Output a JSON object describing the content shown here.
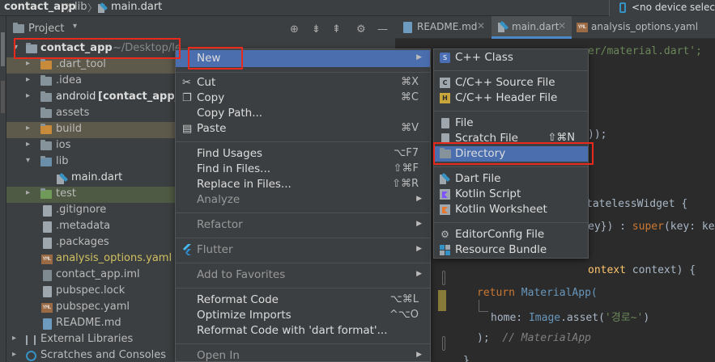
{
  "breadcrumb": {
    "project": "contact_app",
    "folder": "lib",
    "file": "main.dart"
  },
  "device": {
    "label": "<no device selected>"
  },
  "project_panel": {
    "title": "Project",
    "root": {
      "name": "contact_app",
      "path": "~/Desktop/le"
    },
    "items": [
      {
        "label": ".dart_tool",
        "kind": "folder"
      },
      {
        "label": ".idea",
        "kind": "folder"
      },
      {
        "label": "android",
        "bold": "[contact_app_a",
        "kind": "folder"
      },
      {
        "label": "assets",
        "kind": "folder"
      },
      {
        "label": "build",
        "kind": "folder"
      },
      {
        "label": "ios",
        "kind": "folder"
      },
      {
        "label": "lib",
        "kind": "folder"
      },
      {
        "label": "main.dart",
        "kind": "dart"
      },
      {
        "label": "test",
        "kind": "folder"
      },
      {
        "label": ".gitignore",
        "kind": "file"
      },
      {
        "label": ".metadata",
        "kind": "file"
      },
      {
        "label": ".packages",
        "kind": "file"
      },
      {
        "label": "analysis_options.yaml",
        "kind": "yml"
      },
      {
        "label": "contact_app.iml",
        "kind": "file"
      },
      {
        "label": "pubspec.lock",
        "kind": "file"
      },
      {
        "label": "pubspec.yaml",
        "kind": "yml"
      },
      {
        "label": "README.md",
        "kind": "file"
      },
      {
        "label": "External Libraries",
        "kind": "ext"
      },
      {
        "label": "Scratches and Consoles",
        "kind": "scratch"
      }
    ]
  },
  "editor": {
    "tabs": [
      {
        "label": "README.md"
      },
      {
        "label": "main.dart"
      },
      {
        "label": "analysis_options.yaml"
      }
    ],
    "code": {
      "l1": "er/material.dart';",
      "l2": "));",
      "l3a": "tatelessWidget",
      "l3b": " {",
      "l4a": "ey}) : ",
      "l4b": "super",
      "l4c": "(key: ke",
      "l5a": "ontext",
      "l5b": " context) {",
      "l6a": "return",
      "l6b": "MaterialApp(",
      "l7a": "home: ",
      "l7b": "Image",
      "l7c": ".asset(",
      "l7d": "'경로~'",
      "l7e": ")",
      "l8a": ");  ",
      "l8b": "// MaterialApp",
      "l9": "}"
    }
  },
  "context_menu": {
    "items": [
      {
        "label": "New",
        "submenu": true
      },
      {
        "label": "Cut",
        "shortcut": "⌘X",
        "icon": "scissors-icon"
      },
      {
        "label": "Copy",
        "shortcut": "⌘C",
        "icon": "copy-icon"
      },
      {
        "label": "Copy Path..."
      },
      {
        "label": "Paste",
        "shortcut": "⌘V",
        "icon": "paste-icon"
      },
      {
        "label": "Find Usages",
        "shortcut": "⌥F7"
      },
      {
        "label": "Find in Files...",
        "shortcut": "⇧⌘F"
      },
      {
        "label": "Replace in Files...",
        "shortcut": "⇧⌘R"
      },
      {
        "label": "Analyze",
        "submenu": true
      },
      {
        "label": "Refactor",
        "submenu": true
      },
      {
        "label": "Flutter",
        "submenu": true,
        "icon": "flutter-icon"
      },
      {
        "label": "Add to Favorites",
        "submenu": true
      },
      {
        "label": "Reformat Code",
        "shortcut": "⌥⌘L"
      },
      {
        "label": "Optimize Imports",
        "shortcut": "^⌥O"
      },
      {
        "label": "Reformat Code with 'dart format'..."
      },
      {
        "label": "Open In",
        "submenu": true
      }
    ]
  },
  "new_submenu": {
    "items": [
      {
        "label": "C++ Class",
        "icon_text": "S"
      },
      {
        "label": "C/C++ Source File",
        "icon_text": "C"
      },
      {
        "label": "C/C++ Header File",
        "icon_text": "H"
      },
      {
        "label": "File"
      },
      {
        "label": "Scratch File",
        "shortcut": "⇧⌘N"
      },
      {
        "label": "Directory"
      },
      {
        "label": "Dart File"
      },
      {
        "label": "Kotlin Script"
      },
      {
        "label": "Kotlin Worksheet"
      },
      {
        "label": "EditorConfig File"
      },
      {
        "label": "Resource Bundle"
      }
    ]
  },
  "colors": {
    "accent": "#4b6eaf",
    "annotation_red": "#e8291c",
    "panel_bg": "#3c3f41",
    "editor_bg": "#2b2b2b"
  }
}
